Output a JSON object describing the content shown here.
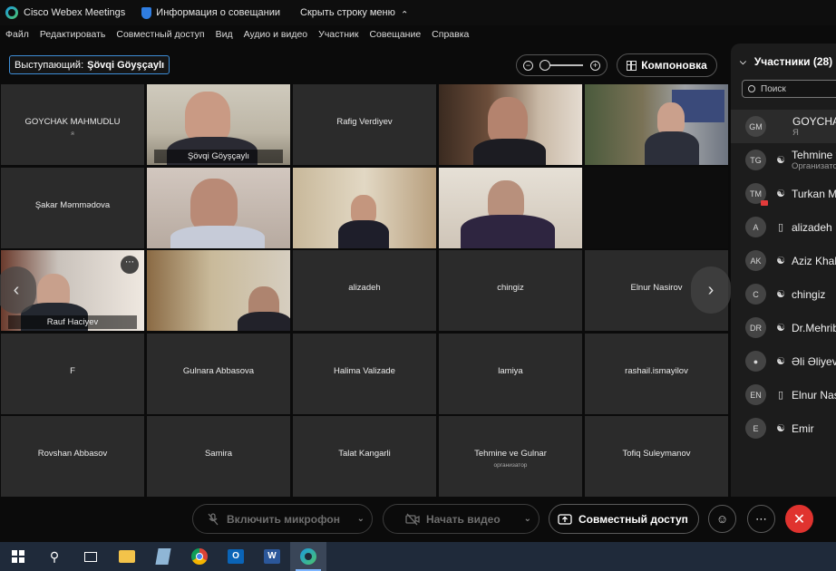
{
  "titlebar": {
    "app_name": "Cisco Webex Meetings",
    "meeting_info": "Информация о совещании",
    "hide_menu": "Скрыть строку меню"
  },
  "menu": [
    "Файл",
    "Редактировать",
    "Совместный доступ",
    "Вид",
    "Аудио и видео",
    "Участник",
    "Совещание",
    "Справка"
  ],
  "presenter": {
    "label": "Выступающий:",
    "name": "Şövqi Göyşçaylı"
  },
  "layout_button": "Компоновка",
  "tiles": [
    {
      "name": "GOYCHAK MAHMUDLU",
      "sub": "я"
    },
    {
      "name": "Şövqi Göyşçaylı",
      "sub": ""
    },
    {
      "name": "Rafig Verdiyev",
      "sub": ""
    },
    {
      "name": "",
      "sub": ""
    },
    {
      "name": "",
      "sub": ""
    },
    {
      "name": "Şakar Məmmədova",
      "sub": ""
    },
    {
      "name": "",
      "sub": ""
    },
    {
      "name": "",
      "sub": ""
    },
    {
      "name": "",
      "sub": ""
    },
    {
      "name": "",
      "sub": ""
    },
    {
      "name": "Rauf Haciyev",
      "sub": ""
    },
    {
      "name": "",
      "sub": ""
    },
    {
      "name": "alizadeh",
      "sub": ""
    },
    {
      "name": "chingiz",
      "sub": ""
    },
    {
      "name": "Elnur Nasirov",
      "sub": ""
    },
    {
      "name": "F",
      "sub": ""
    },
    {
      "name": "Gulnara Abbasova",
      "sub": ""
    },
    {
      "name": "Halima Valizade",
      "sub": ""
    },
    {
      "name": "lamiya",
      "sub": ""
    },
    {
      "name": "rashail.ismayilov",
      "sub": ""
    },
    {
      "name": "Rovshan Abbasov",
      "sub": ""
    },
    {
      "name": "Samira",
      "sub": ""
    },
    {
      "name": "Talat Kangarli",
      "sub": ""
    },
    {
      "name": "Tehmine ve Gulnar",
      "sub": "организатор"
    },
    {
      "name": "Tofiq Suleymanov",
      "sub": ""
    }
  ],
  "participants": {
    "title": "Участники (28)",
    "search_placeholder": "Поиск",
    "list": [
      {
        "initials": "GM",
        "name": "GOYCHAK MAHMUDLU",
        "sub": "Я"
      },
      {
        "initials": "TG",
        "name": "Tehmine ve Gulnar",
        "sub": "Организатор"
      },
      {
        "initials": "TM",
        "name": "Turkan Mammadova",
        "sub": ""
      },
      {
        "initials": "A",
        "name": "alizadeh",
        "sub": ""
      },
      {
        "initials": "AK",
        "name": "Aziz Khalilov",
        "sub": ""
      },
      {
        "initials": "C",
        "name": "chingiz",
        "sub": ""
      },
      {
        "initials": "DR",
        "name": "Dr.Mehriban",
        "sub": ""
      },
      {
        "initials": "",
        "name": "Əli Əliyev",
        "sub": ""
      },
      {
        "initials": "EN",
        "name": "Elnur Nasirov",
        "sub": ""
      },
      {
        "initials": "E",
        "name": "Emir",
        "sub": ""
      }
    ]
  },
  "controls": {
    "mic": "Включить микрофон",
    "video": "Начать видео",
    "share": "Совместный доступ"
  },
  "colors": {
    "accent": "#36a3e8",
    "end_call": "#e0332f",
    "tile_bg": "#2b2b2b"
  }
}
